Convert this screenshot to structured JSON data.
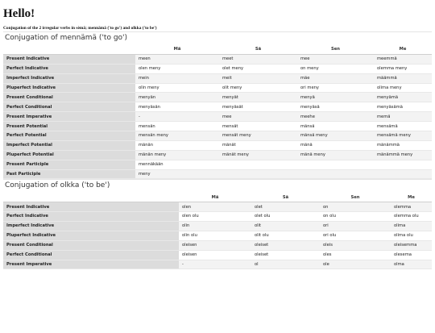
{
  "page": {
    "title": "Hello!",
    "intro": "Conjugation of the 2 irregular verbs in sèmä; mennämä ('to go') and olkka ('to be')"
  },
  "tables": [
    {
      "title": "Conjugation of mennämä ('to go')",
      "headers": [
        "",
        "Mä",
        "Sä",
        "Sen",
        "Me"
      ],
      "rows": [
        {
          "label": "Present Indicative",
          "cells": [
            "meen",
            "meet",
            "mee",
            "meemmä"
          ]
        },
        {
          "label": "Perfect Indicative",
          "cells": [
            "olen meny",
            "olet meny",
            "on meny",
            "olemma meny"
          ]
        },
        {
          "label": "Imperfect Indicative",
          "cells": [
            "mein",
            "meit",
            "mäe",
            "määmmä"
          ]
        },
        {
          "label": "Pluperfect Indicative",
          "cells": [
            "olin meny",
            "olit meny",
            "ori meny",
            "olima meny"
          ]
        },
        {
          "label": "Present Conditional",
          "cells": [
            "menyän",
            "menyät",
            "menyä",
            "menyämä"
          ]
        },
        {
          "label": "Perfect Conditional",
          "cells": [
            "menyäsän",
            "menyäsät",
            "menyäsä",
            "menyäsämä"
          ]
        },
        {
          "label": "Present Imperative",
          "cells": [
            "-",
            "mee",
            "meehe",
            "memä"
          ]
        },
        {
          "label": "Present Potential",
          "cells": [
            "mensän",
            "mensät",
            "mänsä",
            "mensämä"
          ]
        },
        {
          "label": "Perfect Potential",
          "cells": [
            "mensän meny",
            "mensät meny",
            "mänsä meny",
            "mensämä meny"
          ]
        },
        {
          "label": "Imperfect Potential",
          "cells": [
            "mänän",
            "mänät",
            "mänä",
            "mänämmä"
          ]
        },
        {
          "label": "Pluperfect Potential",
          "cells": [
            "mänän meny",
            "mänät meny",
            "mänä meny",
            "mänämmä meny"
          ]
        },
        {
          "label": "Present Participle",
          "cells": [
            "mennäkään",
            "",
            "",
            ""
          ]
        },
        {
          "label": "Past Participle",
          "cells": [
            "meny",
            "",
            "",
            ""
          ]
        }
      ]
    },
    {
      "title": "Conjugation of olkka ('to be')",
      "headers": [
        "",
        "Mä",
        "Sä",
        "Sen",
        "Me"
      ],
      "rows": [
        {
          "label": "Present Indicative",
          "cells": [
            "olen",
            "olet",
            "on",
            "olemma"
          ]
        },
        {
          "label": "Perfect Indicative",
          "cells": [
            "olen olu",
            "olet olu",
            "on olu",
            "olemma olu"
          ]
        },
        {
          "label": "Imperfect Indicative",
          "cells": [
            "olin",
            "olit",
            "ori",
            "olima"
          ]
        },
        {
          "label": "Pluperfect Indicative",
          "cells": [
            "olin olu",
            "olit olu",
            "ori olu",
            "olima olu"
          ]
        },
        {
          "label": "Present Conditional",
          "cells": [
            "oleisen",
            "oleiset",
            "oleis",
            "oleisemma"
          ]
        },
        {
          "label": "Perfect Conditional",
          "cells": [
            "oleisen",
            "oleiset",
            "oles",
            "olesema"
          ]
        },
        {
          "label": "Present Imperative",
          "cells": [
            "-",
            "ol",
            "ole",
            "olma"
          ]
        }
      ]
    }
  ]
}
